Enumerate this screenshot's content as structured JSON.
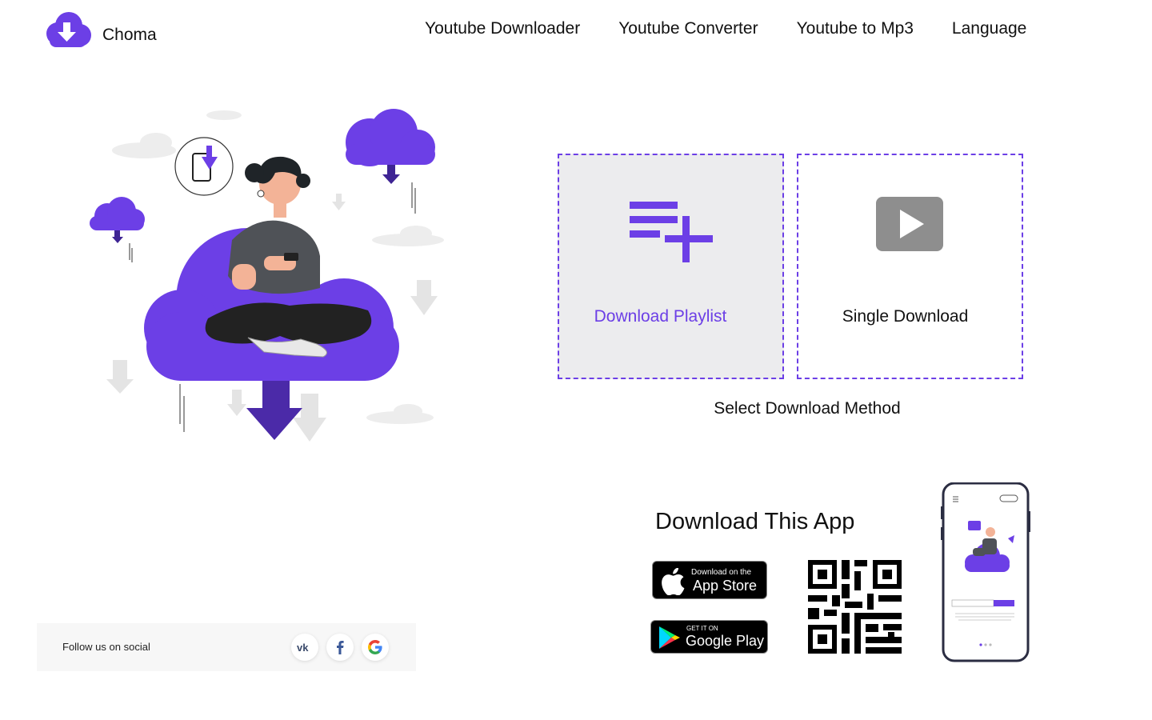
{
  "brand": {
    "name": "Choma",
    "accent": "#6c3fe6",
    "accent_dark": "#4b2aa8"
  },
  "nav": {
    "items": [
      {
        "label": "Youtube Downloader"
      },
      {
        "label": "Youtube Converter"
      },
      {
        "label": "Youtube to Mp3"
      },
      {
        "label": "Language"
      }
    ]
  },
  "download_methods": {
    "playlist": {
      "label": "Download Playlist",
      "icon": "playlist-add-icon",
      "selected": true
    },
    "single": {
      "label": "Single Download",
      "icon": "play-icon",
      "selected": false
    },
    "caption": "Select Download Method"
  },
  "social": {
    "label": "Follow us on social",
    "icons": [
      "vk-icon",
      "facebook-icon",
      "google-icon"
    ]
  },
  "app": {
    "title": "Download This App",
    "app_store": {
      "small": "Download on the",
      "big": "App Store"
    },
    "google_play": {
      "small": "GET IT ON",
      "big": "Google Play"
    },
    "qr_icon": "qr-code-icon",
    "phone_mockup": "phone-preview-image"
  }
}
